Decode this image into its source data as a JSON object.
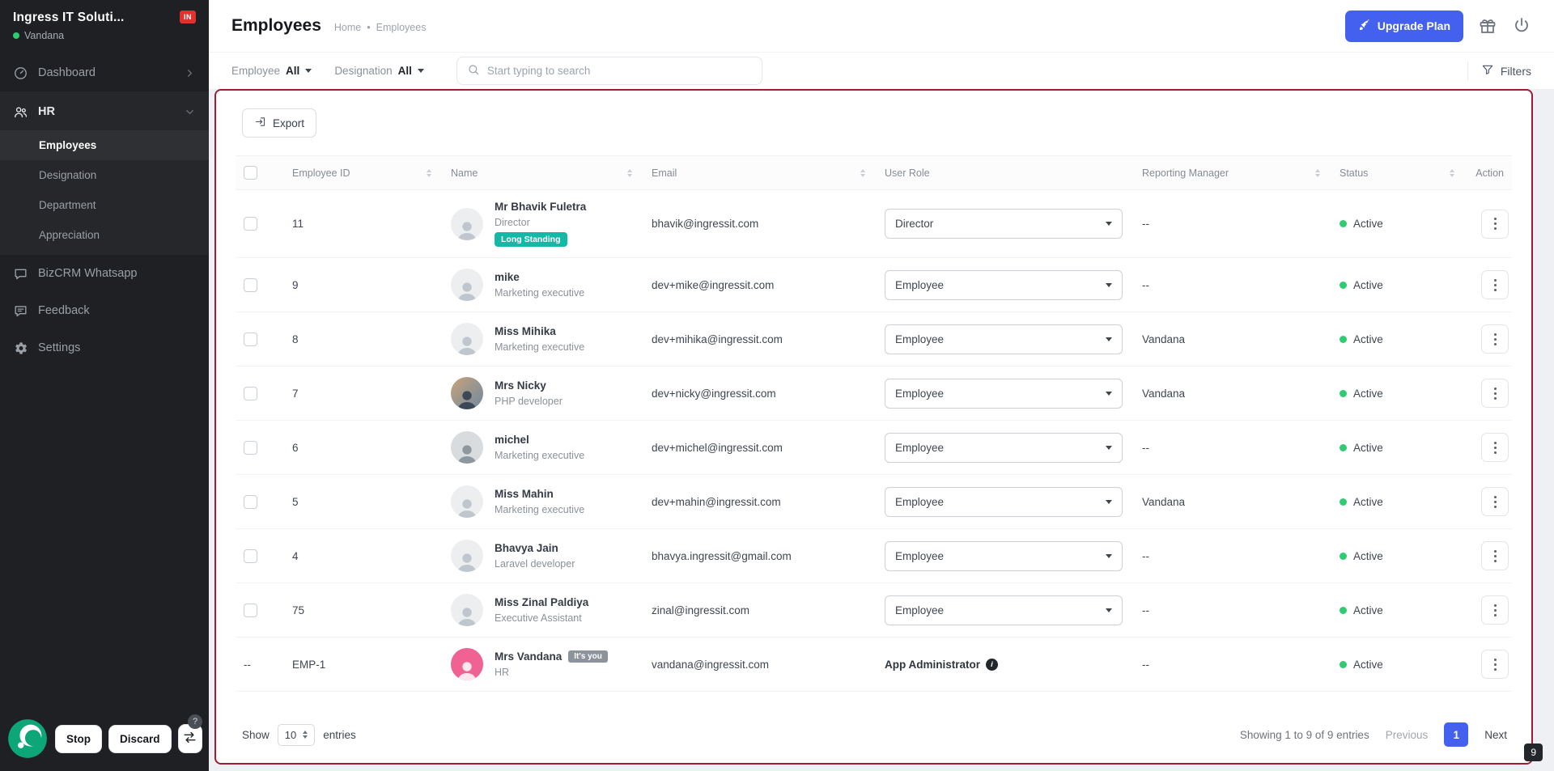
{
  "app": {
    "title": "Employees"
  },
  "colors": {
    "accent": "#4361ee",
    "panel_border": "#a11c33",
    "status_green": "#2ecc71",
    "badge_teal": "#14b8a6",
    "sidebar_bg": "#1f2023"
  },
  "sidebar": {
    "org_name": "Ingress IT Soluti...",
    "org_badge": "IN",
    "user_name": "Vandana",
    "nav": {
      "dashboard": "Dashboard",
      "hr": "HR",
      "hr_sub": [
        "Employees",
        "Designation",
        "Department",
        "Appreciation"
      ],
      "bizcrm": "BizCRM Whatsapp",
      "feedback": "Feedback",
      "settings": "Settings"
    },
    "controls": {
      "stop": "Stop",
      "discard": "Discard",
      "help": "?"
    }
  },
  "header": {
    "title": "Employees",
    "breadcrumb_home": "Home",
    "breadcrumb_sep": "•",
    "breadcrumb_current": "Employees",
    "upgrade_label": "Upgrade Plan"
  },
  "filterbar": {
    "employee_label": "Employee",
    "employee_value": "All",
    "designation_label": "Designation",
    "designation_value": "All",
    "search_placeholder": "Start typing to search",
    "filters_label": "Filters"
  },
  "toolbar": {
    "export_label": "Export"
  },
  "table": {
    "columns": [
      "Employee ID",
      "Name",
      "Email",
      "User Role",
      "Reporting Manager",
      "Status",
      "Action"
    ],
    "rows": [
      {
        "selectable": true,
        "id": "11",
        "name": "Mr Bhavik Fuletra",
        "designation": "Director",
        "tag": "Long Standing",
        "email": "bhavik@ingressit.com",
        "role": "Director",
        "role_editable": true,
        "manager": "--",
        "status": "Active",
        "avatar": "gray"
      },
      {
        "selectable": true,
        "id": "9",
        "name": "mike",
        "designation": "Marketing executive",
        "email": "dev+mike@ingressit.com",
        "role": "Employee",
        "role_editable": true,
        "manager": "--",
        "status": "Active",
        "avatar": "gray"
      },
      {
        "selectable": true,
        "id": "8",
        "name": "Miss Mihika",
        "designation": "Marketing executive",
        "email": "dev+mihika@ingressit.com",
        "role": "Employee",
        "role_editable": true,
        "manager": "Vandana",
        "status": "Active",
        "avatar": "gray"
      },
      {
        "selectable": true,
        "id": "7",
        "name": "Mrs Nicky",
        "designation": "PHP developer",
        "email": "dev+nicky@ingressit.com",
        "role": "Employee",
        "role_editable": true,
        "manager": "Vandana",
        "status": "Active",
        "avatar": "photo"
      },
      {
        "selectable": true,
        "id": "6",
        "name": "michel",
        "designation": "Marketing executive",
        "email": "dev+michel@ingressit.com",
        "role": "Employee",
        "role_editable": true,
        "manager": "--",
        "status": "Active",
        "avatar": "photo2"
      },
      {
        "selectable": true,
        "id": "5",
        "name": "Miss Mahin",
        "designation": "Marketing executive",
        "email": "dev+mahin@ingressit.com",
        "role": "Employee",
        "role_editable": true,
        "manager": "Vandana",
        "status": "Active",
        "avatar": "gray"
      },
      {
        "selectable": true,
        "id": "4",
        "name": "Bhavya Jain",
        "designation": "Laravel developer",
        "email": "bhavya.ingressit@gmail.com",
        "role": "Employee",
        "role_editable": true,
        "manager": "--",
        "status": "Active",
        "avatar": "gray"
      },
      {
        "selectable": true,
        "id": "75",
        "name": "Miss Zinal Paldiya",
        "designation": "Executive Assistant",
        "email": "zinal@ingressit.com",
        "role": "Employee",
        "role_editable": true,
        "manager": "--",
        "status": "Active",
        "avatar": "gray"
      },
      {
        "selectable": false,
        "select_placeholder": "--",
        "id": "EMP-1",
        "name": "Mrs Vandana",
        "name_badge": "It's you",
        "designation": "HR",
        "email": "vandana@ingressit.com",
        "role": "App Administrator",
        "role_editable": false,
        "manager": "--",
        "status": "Active",
        "avatar": "pink"
      }
    ]
  },
  "pagination": {
    "show": "Show",
    "page_size": "10",
    "entries": "entries",
    "summary": "Showing 1 to 9 of 9 entries",
    "previous": "Previous",
    "page": "1",
    "next": "Next"
  },
  "corner_badge": "9"
}
